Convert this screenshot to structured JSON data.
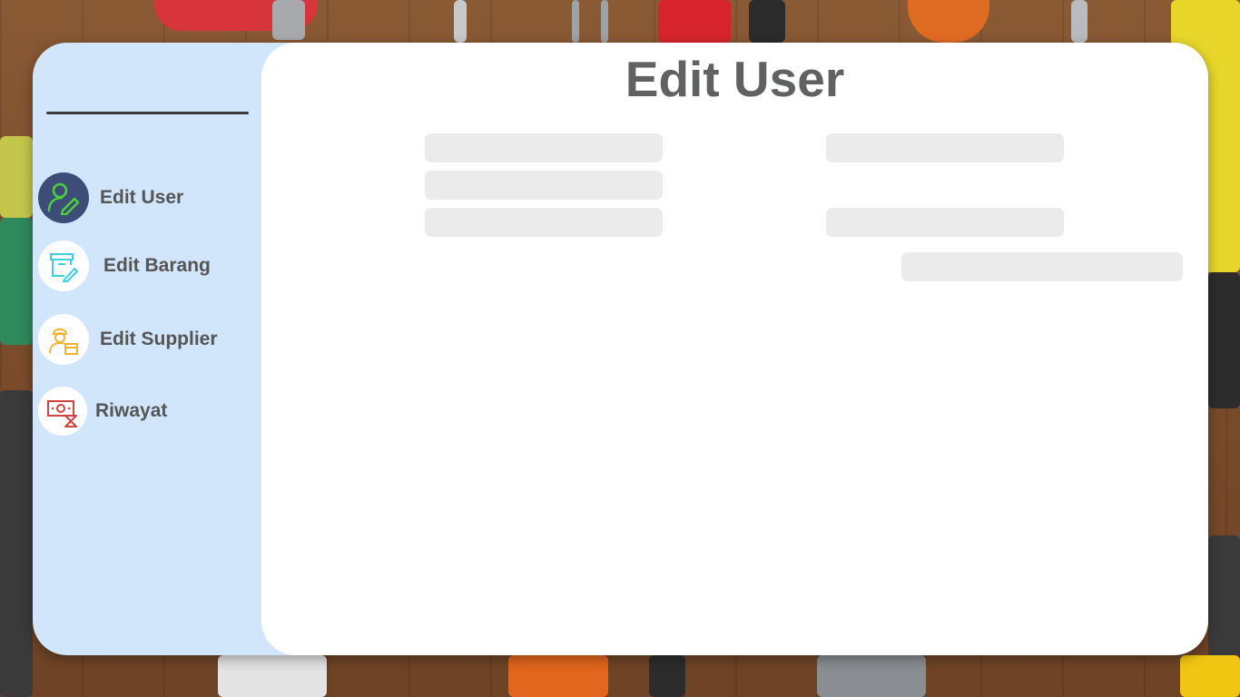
{
  "page": {
    "title": "Edit User"
  },
  "sidebar": {
    "items": [
      {
        "label": "Edit User",
        "icon": "user-edit-icon",
        "active": true
      },
      {
        "label": "Edit Barang",
        "icon": "box-edit-icon",
        "active": false
      },
      {
        "label": "Edit Supplier",
        "icon": "supplier-icon",
        "active": false
      },
      {
        "label": "Riwayat",
        "icon": "money-history-icon",
        "active": false
      }
    ]
  },
  "form": {
    "field_1": {
      "value": "",
      "placeholder": ""
    },
    "field_2": {
      "value": "",
      "placeholder": ""
    },
    "field_3": {
      "value": "",
      "placeholder": ""
    },
    "field_4": {
      "value": "",
      "placeholder": ""
    },
    "field_5": {
      "value": "",
      "placeholder": ""
    },
    "submit_label": ""
  },
  "colors": {
    "sidebar_bg": "#d2e6fb",
    "active_icon_bg": "#3d4d78",
    "nav_text": "#555555",
    "title_text": "#5f6163",
    "field_bg": "#ebebeb",
    "user_icon": "#4cd13d",
    "box_icon": "#3ccfe0",
    "supplier_icon": "#f2b233",
    "history_icon": "#d2423e"
  }
}
